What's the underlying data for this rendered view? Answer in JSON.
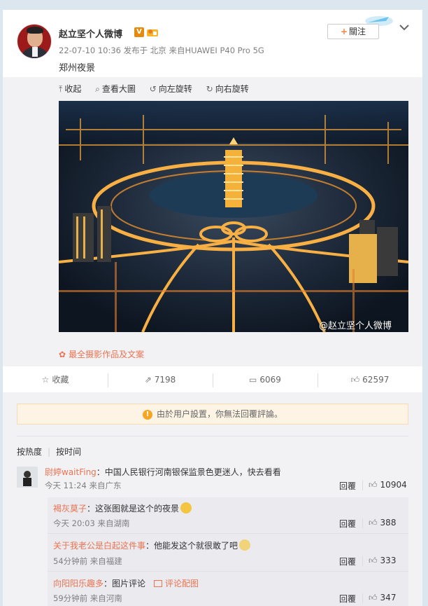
{
  "post": {
    "author": "赵立坚个人微博",
    "meta": "22-07-10 10:36 发布于 北京 来自HUAWEI P40 Pro 5G",
    "text": "郑州夜景",
    "follow_label": "關注",
    "vip_badge": "V"
  },
  "media_toolbar": {
    "collapse": "收起",
    "view_large": "查看大圖",
    "rotate_left": "向左旋转",
    "rotate_right": "向右旋转"
  },
  "photo": {
    "watermark": "@赵立坚个人微博"
  },
  "source_link": "最全摄影作品及文案",
  "actions": {
    "favorite": "收藏",
    "repost_count": "7198",
    "comment_count": "6069",
    "like_count": "62597"
  },
  "notice": "由於用户設置，你無法回覆評論。",
  "sort": {
    "by_hot": "按热度",
    "by_time": "按时间"
  },
  "comments": [
    {
      "user": "尉婷waitFing",
      "text": "：中国人民银行河南银保监景色更迷人，快去看看",
      "meta": "今天 11:24 来自广东",
      "reply": "回覆",
      "likes": "10904"
    }
  ],
  "sub_comments": [
    {
      "user": "褐灰莫子",
      "text": "：这张图就是这个的夜景",
      "meta": "今天 20:03 来自湖南",
      "reply": "回覆",
      "likes": "388"
    },
    {
      "user": "关于我老公是白起这件事",
      "text": "：他能发这个就很敢了吧",
      "meta": "54分钟前 来自福建",
      "reply": "回覆",
      "likes": "333"
    },
    {
      "user": "向阳阳乐趣多",
      "text": "：图片评论",
      "extra": "评论配图",
      "meta": "59分钟前 来自河南",
      "reply": "回覆",
      "likes": "347"
    }
  ],
  "colors": {
    "link_orange": "#eb7350",
    "page_bg": "#dbe6ef",
    "notice_bg": "#fdf4e5"
  }
}
